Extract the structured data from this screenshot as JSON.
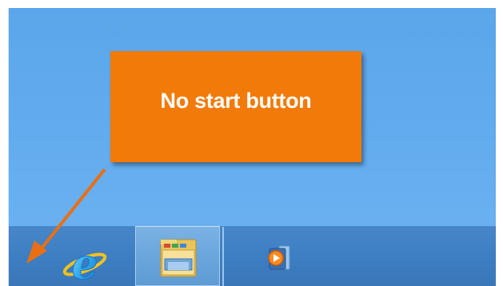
{
  "callout": {
    "text": "No start button"
  },
  "taskbar": {
    "pinned": [
      {
        "icon": "internet-explorer-icon"
      },
      {
        "icon": "file-explorer-icon",
        "active": true
      },
      {
        "icon": "windows-media-player-icon"
      }
    ]
  },
  "colors": {
    "desktop_top": "#5ba6ea",
    "desktop_bottom": "#6fb4f2",
    "taskbar": "#3d7dc1",
    "callout": "#f27a08",
    "arrow": "#e96f12"
  }
}
